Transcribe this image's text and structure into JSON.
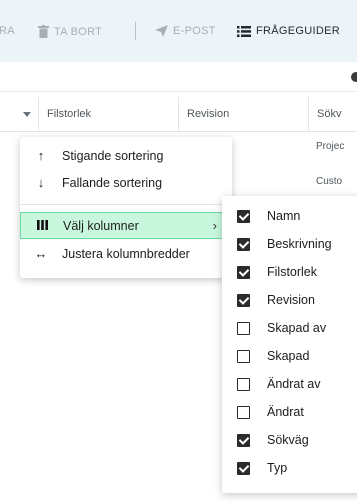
{
  "toolbar": {
    "partial_left": "RA",
    "delete_label": "TA BORT",
    "email_label": "E-POST",
    "guides_label": "FRÅGEGUIDER"
  },
  "grid": {
    "columns": [
      "Filstorlek",
      "Revision",
      "Sökv"
    ],
    "visible_cells": [
      "Projec",
      "Custo"
    ]
  },
  "column_menu": {
    "items": [
      {
        "label": "Stigande sortering",
        "icon": "arrow-up-icon"
      },
      {
        "label": "Fallande sortering",
        "icon": "arrow-down-icon"
      },
      {
        "label": "Välj kolumner",
        "icon": "columns-icon",
        "active": true
      },
      {
        "label": "Justera kolumnbredder",
        "icon": "arrows-horizontal-icon"
      }
    ]
  },
  "columns_submenu": {
    "items": [
      {
        "label": "Namn",
        "checked": true
      },
      {
        "label": "Beskrivning",
        "checked": true
      },
      {
        "label": "Filstorlek",
        "checked": true
      },
      {
        "label": "Revision",
        "checked": true
      },
      {
        "label": "Skapad av",
        "checked": false
      },
      {
        "label": "Skapad",
        "checked": false
      },
      {
        "label": "Ändrat av",
        "checked": false
      },
      {
        "label": "Ändrat",
        "checked": false
      },
      {
        "label": "Sökväg",
        "checked": true
      },
      {
        "label": "Typ",
        "checked": true
      }
    ]
  },
  "colors": {
    "toolbar_bg": "#edf4f7",
    "active_item_bg": "#c8f7de",
    "active_item_border": "#6fd8a1"
  }
}
